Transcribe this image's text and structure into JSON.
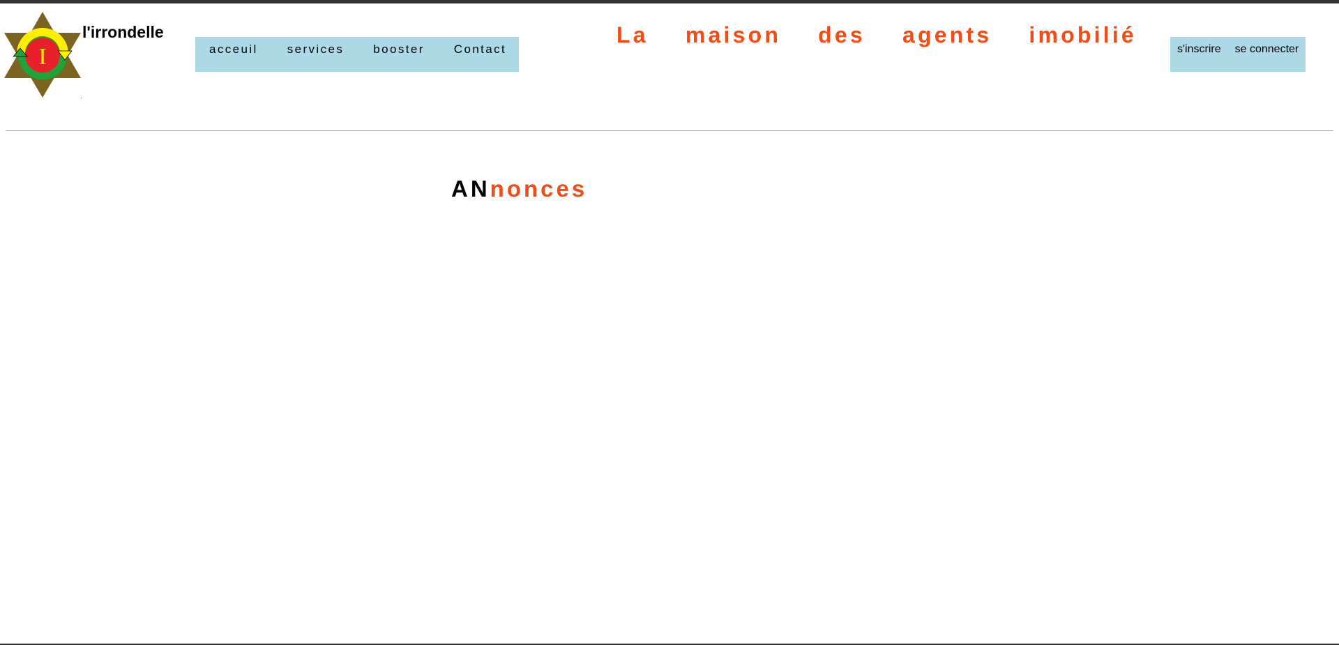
{
  "brand": {
    "name": "l'irrondelle",
    "logo_icon": "star-of-david-logo-icon",
    "logo_letter": "I"
  },
  "main_nav": {
    "items": [
      {
        "label": "acceuil"
      },
      {
        "label": "services"
      },
      {
        "label": "booster"
      },
      {
        "label": "Contact"
      }
    ]
  },
  "tagline": {
    "text": "La maison des agents imobilié"
  },
  "auth_nav": {
    "signup_label": "s'inscrire",
    "login_label": "se connecter"
  },
  "section": {
    "title_prefix": "AN",
    "title_rest": "nonces"
  },
  "colors": {
    "accent": "#f04d17",
    "nav_background": "#add8e6",
    "star": "#7a6420",
    "logo_circle_red": "#e8202a",
    "logo_ring_green": "#1fa33a",
    "logo_arc_yellow": "#ffee00",
    "top_bar": "#333333"
  }
}
